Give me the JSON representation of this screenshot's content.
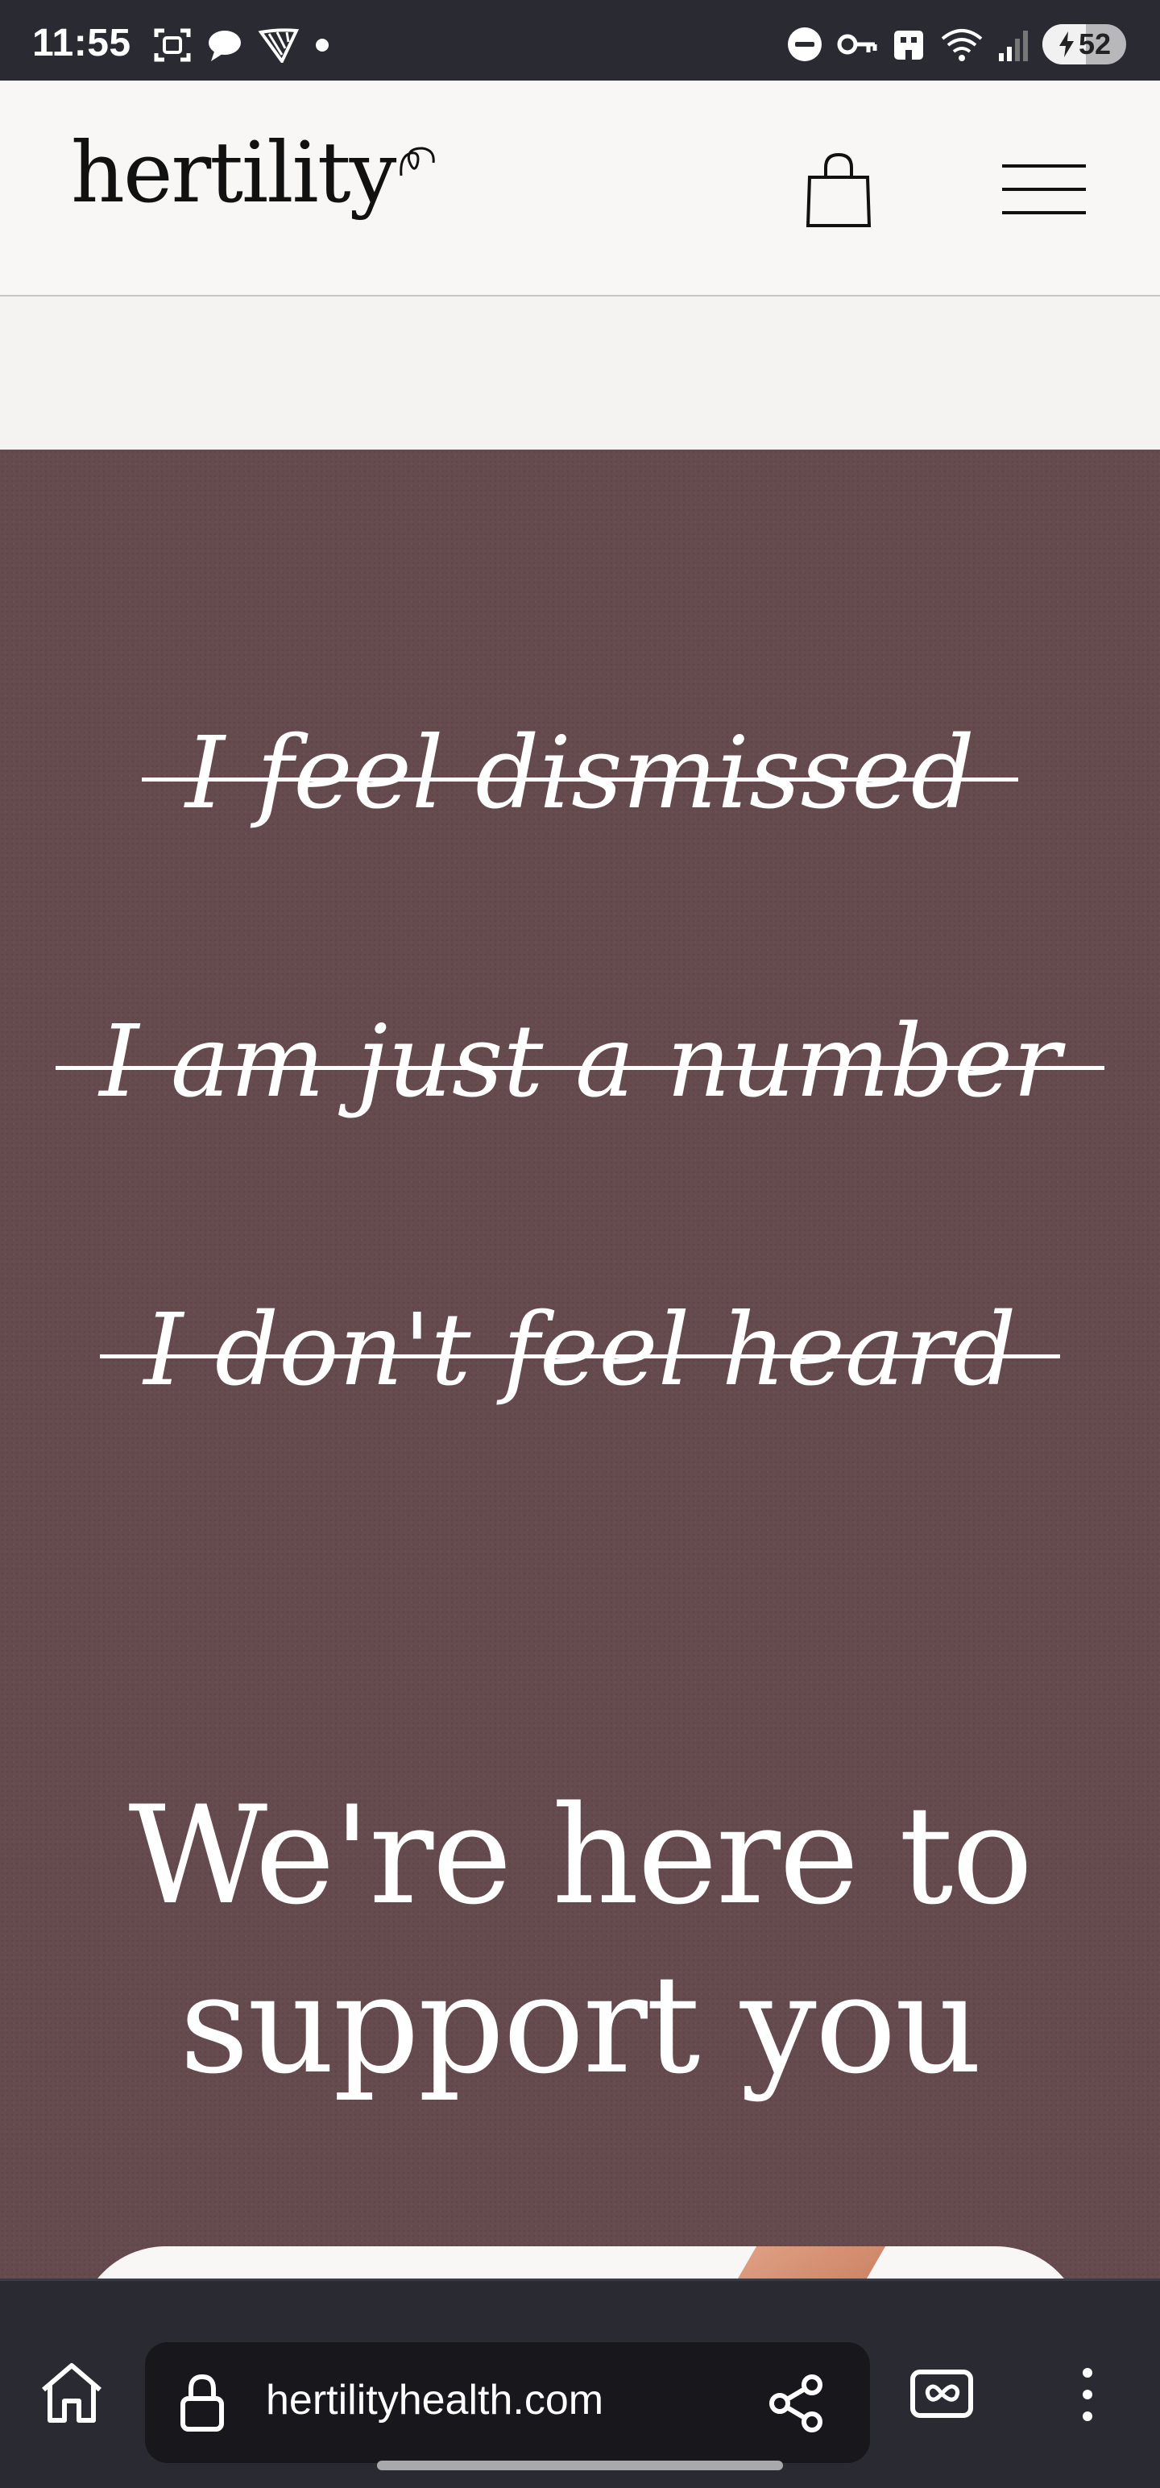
{
  "status_bar": {
    "time": "11:55",
    "battery_level": "52",
    "icons_left": [
      "screenshot-icon",
      "chat-bubble-icon",
      "airline-icon",
      "dot-icon"
    ],
    "icons_right": [
      "do-not-disturb-icon",
      "vpn-key-icon",
      "work-profile-icon",
      "wifi-icon",
      "signal-icon",
      "battery-charging-icon"
    ]
  },
  "header": {
    "logo_text": "hertility",
    "cart_icon": "shopping-bag-icon",
    "menu_icon": "hamburger-menu-icon"
  },
  "hero": {
    "background_color": "#654a4e",
    "struck_phrases": [
      "I feel dismissed",
      "I am just a number",
      "I don't feel heard"
    ],
    "headline_line1": "We're here to",
    "headline_line2": "support you"
  },
  "browser": {
    "url": "hertilityhealth.com",
    "home_icon": "home-icon",
    "lock_icon": "lock-icon",
    "share_icon": "share-icon",
    "tabs_icon": "tab-switcher-icon",
    "more_icon": "more-vertical-icon"
  }
}
